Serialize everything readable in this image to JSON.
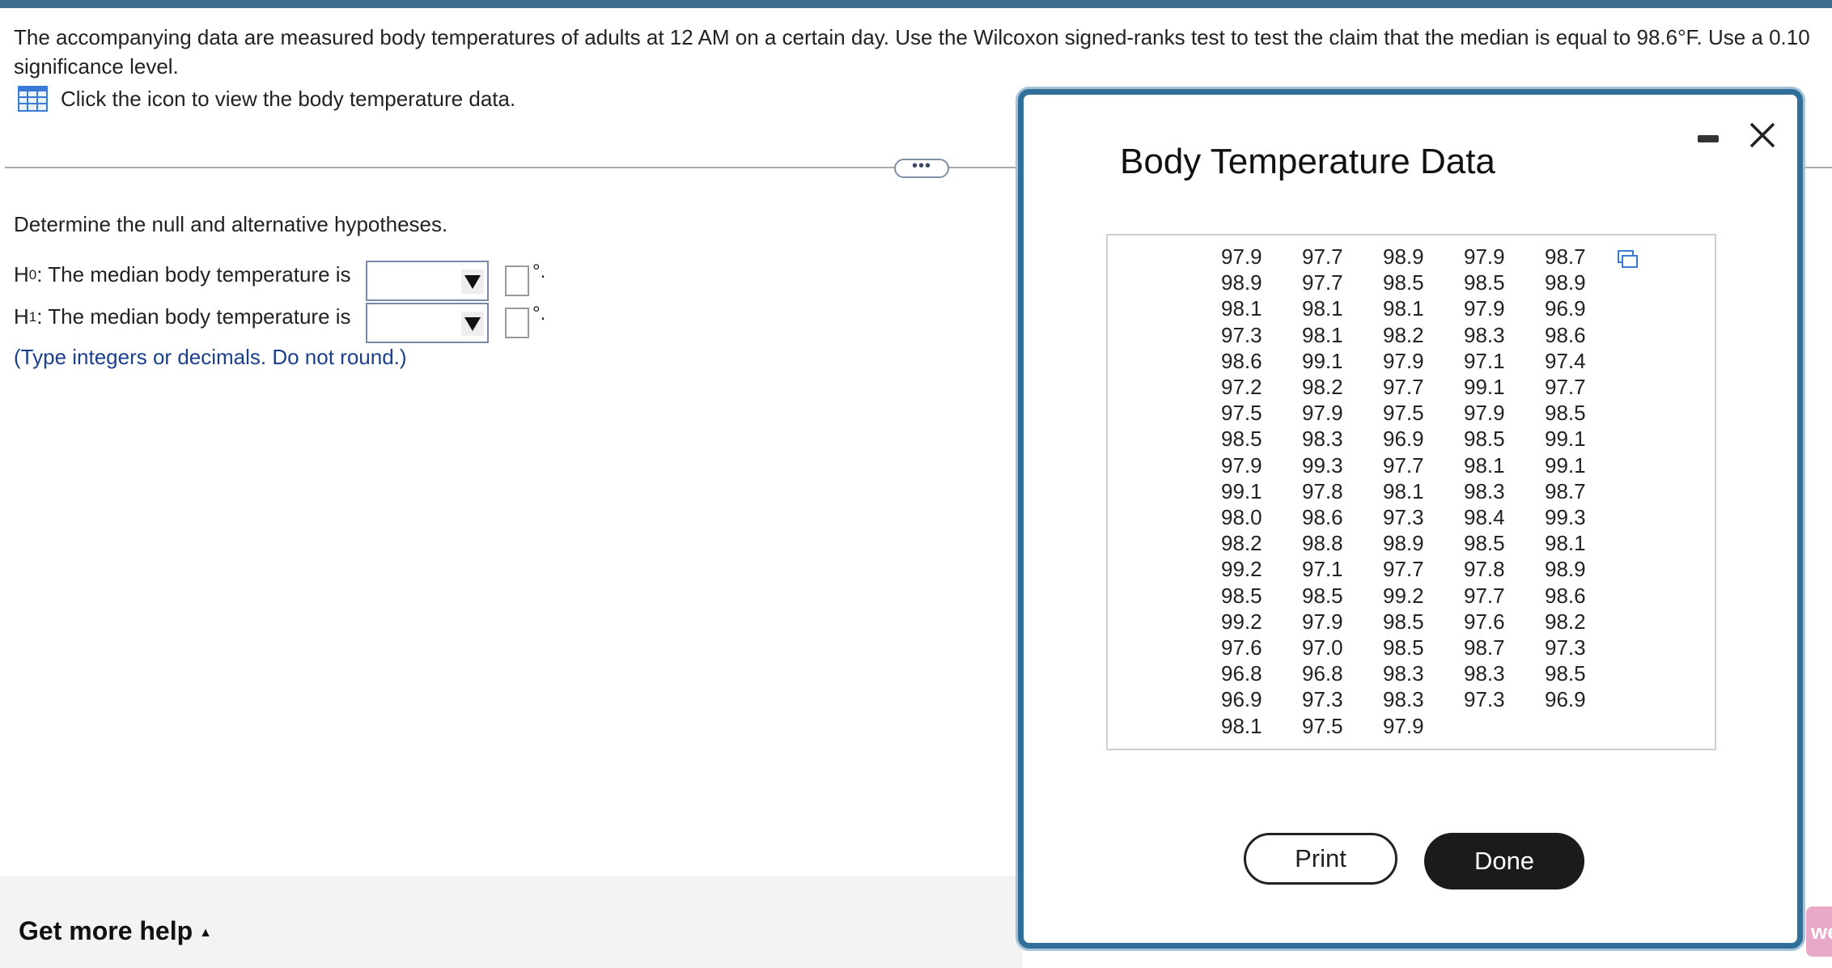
{
  "question": {
    "text": "The accompanying data are measured body temperatures of adults at 12 AM on a certain day. Use the Wilcoxon signed-ranks test to test the claim that the median is equal to 98.6°F. Use a 0.10 significance level."
  },
  "data_link": {
    "label": "Click the icon to view the body temperature data.",
    "icon": "table-grid-icon"
  },
  "more_button": {
    "label": "•••"
  },
  "instructions": "Determine the null and alternative hypotheses.",
  "hypotheses": [
    {
      "symbol": "H",
      "subscript": "0",
      "text": ": The median body temperature is",
      "selected": "",
      "value": "",
      "unit": "°."
    },
    {
      "symbol": "H",
      "subscript": "1",
      "text": ": The median body temperature is",
      "selected": "",
      "value": "",
      "unit": "°."
    }
  ],
  "hint": "(Type integers or decimals. Do not round.)",
  "footer": {
    "help_label": "Get more help",
    "caret": "▲",
    "badge_text": "we"
  },
  "modal": {
    "title": "Body Temperature Data",
    "rows": [
      [
        "97.9",
        "97.7",
        "98.9",
        "97.9",
        "98.7"
      ],
      [
        "98.9",
        "97.7",
        "98.5",
        "98.5",
        "98.9"
      ],
      [
        "98.1",
        "98.1",
        "98.1",
        "97.9",
        "96.9"
      ],
      [
        "97.3",
        "98.1",
        "98.2",
        "98.3",
        "98.6"
      ],
      [
        "98.6",
        "99.1",
        "97.9",
        "97.1",
        "97.4"
      ],
      [
        "97.2",
        "98.2",
        "97.7",
        "99.1",
        "97.7"
      ],
      [
        "97.5",
        "97.9",
        "97.5",
        "97.9",
        "98.5"
      ],
      [
        "98.5",
        "98.3",
        "96.9",
        "98.5",
        "99.1"
      ],
      [
        "97.9",
        "99.3",
        "97.7",
        "98.1",
        "99.1"
      ],
      [
        "99.1",
        "97.8",
        "98.1",
        "98.3",
        "98.7"
      ],
      [
        "98.0",
        "98.6",
        "97.3",
        "98.4",
        "99.3"
      ],
      [
        "98.2",
        "98.8",
        "98.9",
        "98.5",
        "98.1"
      ],
      [
        "99.2",
        "97.1",
        "97.7",
        "97.8",
        "98.9"
      ],
      [
        "98.5",
        "98.5",
        "99.2",
        "97.7",
        "98.6"
      ],
      [
        "99.2",
        "97.9",
        "98.5",
        "97.6",
        "98.2"
      ],
      [
        "97.6",
        "97.0",
        "98.5",
        "98.7",
        "97.3"
      ],
      [
        "96.8",
        "96.8",
        "98.3",
        "98.3",
        "98.5"
      ],
      [
        "96.9",
        "97.3",
        "98.3",
        "97.3",
        "96.9"
      ],
      [
        "98.1",
        "97.5",
        "97.9",
        "",
        ""
      ]
    ],
    "print_label": "Print",
    "done_label": "Done",
    "colors": {
      "border": "#2f6f99",
      "done_bg": "#1b1b1b",
      "hint": "#1a3f8c",
      "topbar": "#3d6f8c"
    }
  }
}
